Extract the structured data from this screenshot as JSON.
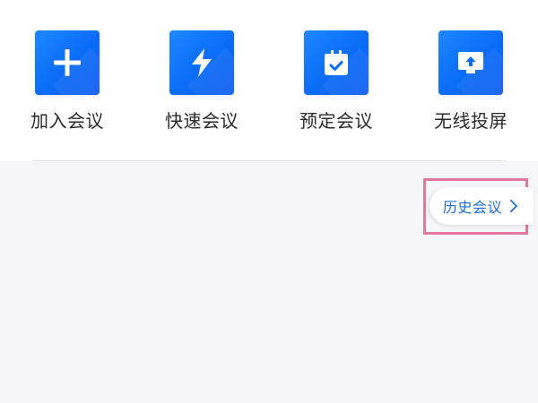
{
  "quick_actions": [
    {
      "label": "加入会议",
      "icon": "plus-icon"
    },
    {
      "label": "快速会议",
      "icon": "lightning-icon"
    },
    {
      "label": "预定会议",
      "icon": "calendar-check-icon"
    },
    {
      "label": "无线投屏",
      "icon": "screen-cast-icon"
    }
  ],
  "history": {
    "label": "历史会议",
    "icon": "chevron-right-icon"
  },
  "colors": {
    "accent": "#0a6cf7",
    "history_text": "#1b6fd8",
    "highlight_border": "#e1789f",
    "panel_bg": "#ffffff",
    "page_bg": "#f6f6f8"
  }
}
